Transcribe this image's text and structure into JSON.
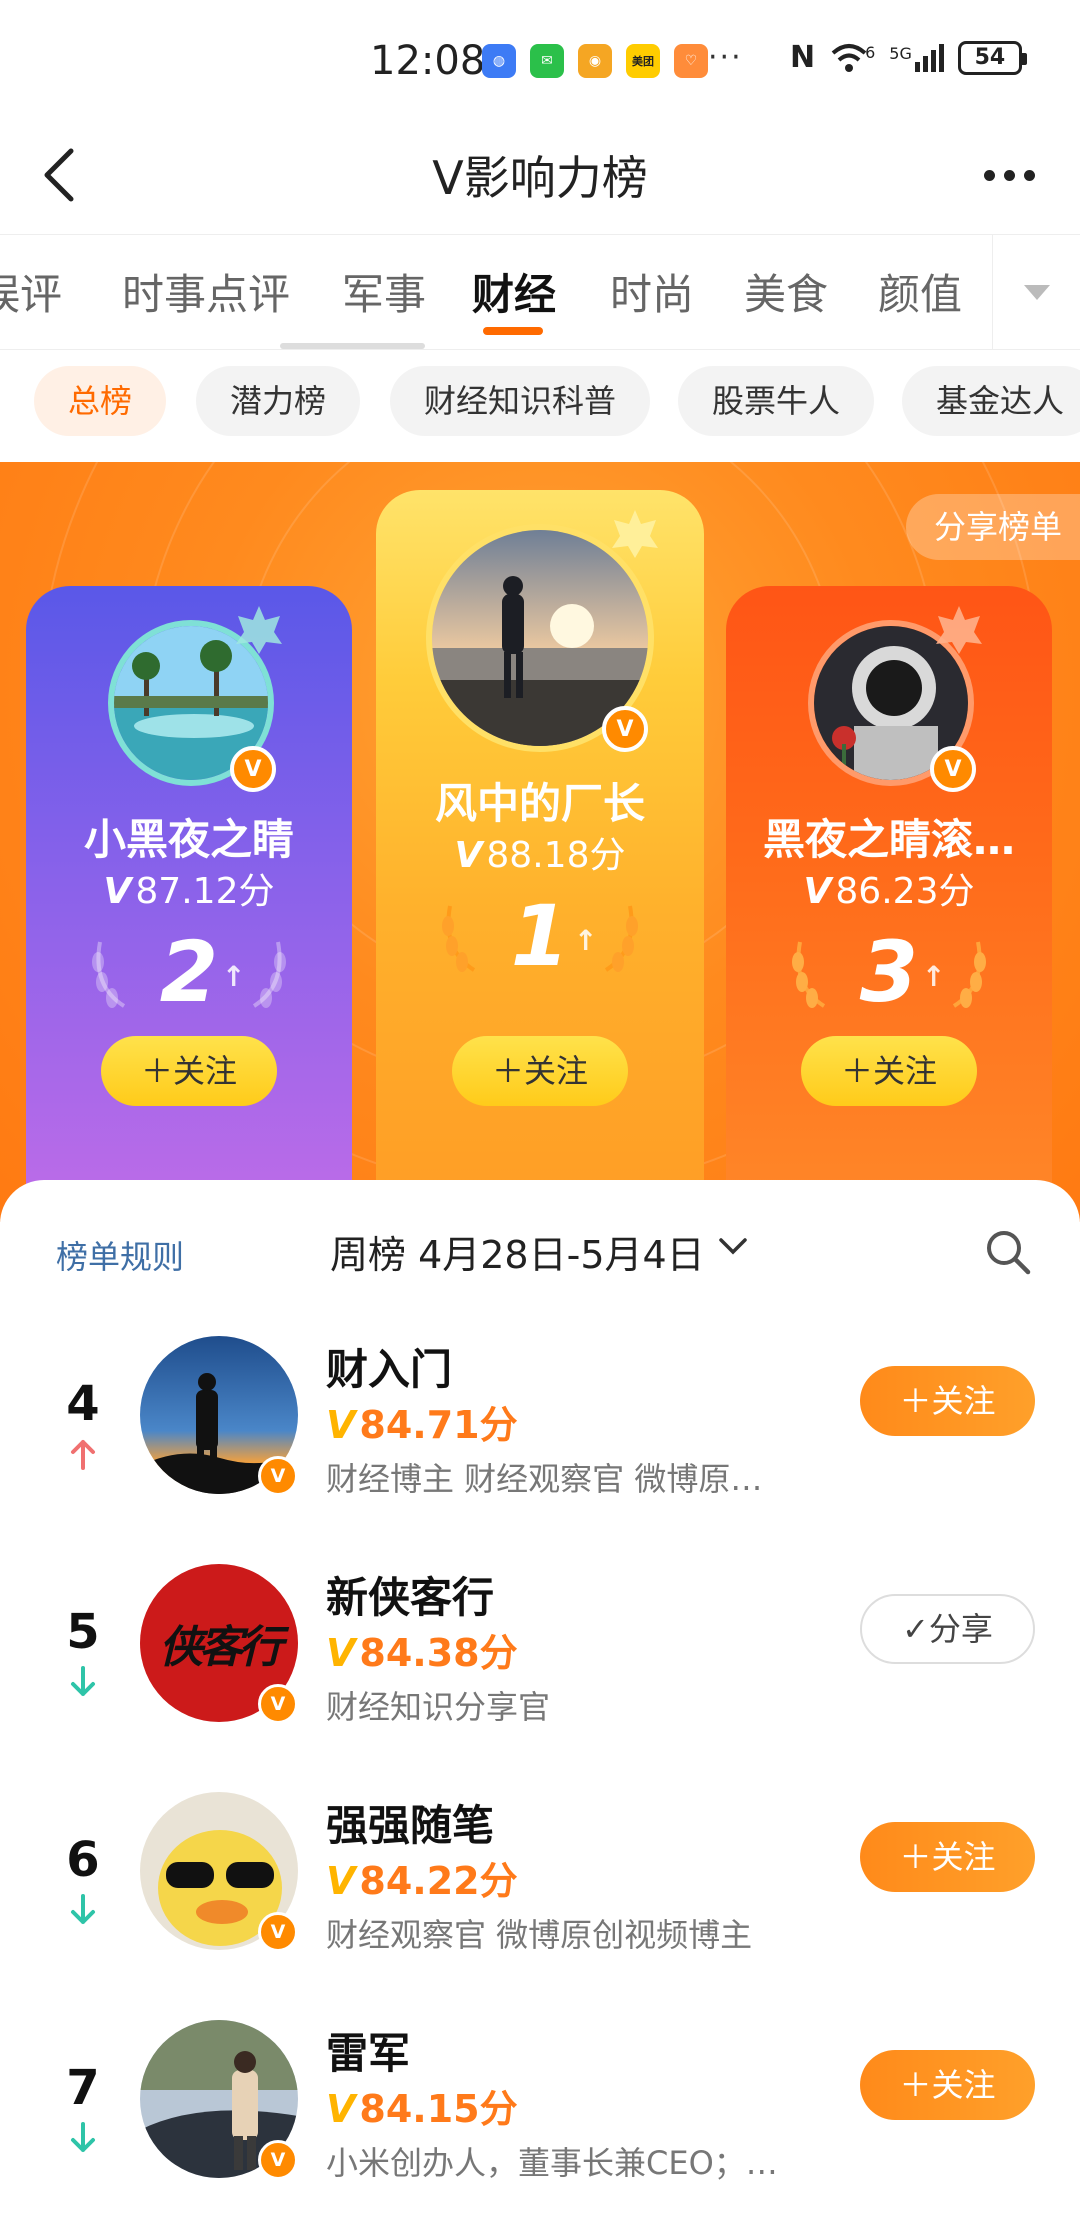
{
  "status_bar": {
    "time": "12:08",
    "app_icons": [
      {
        "name": "blue-app-icon",
        "color": "#3d7bf5",
        "glyph": "◍"
      },
      {
        "name": "wechat-icon",
        "color": "#2bc04a",
        "glyph": "✉"
      },
      {
        "name": "weibo-icon",
        "color": "#f5a623",
        "glyph": "◉"
      },
      {
        "name": "meituan-icon",
        "color": "#ffcc00",
        "glyph": "美团"
      },
      {
        "name": "orange-app-icon",
        "color": "#ff8c3a",
        "glyph": "♡"
      }
    ],
    "more": "···",
    "nfc": "N",
    "wifi_label": "6",
    "network_label": "5G",
    "battery": "54"
  },
  "header": {
    "title": "V影响力榜"
  },
  "category_tabs": [
    {
      "label": "娱评"
    },
    {
      "label": "时事点评"
    },
    {
      "label": "军事"
    },
    {
      "label": "财经",
      "active": true
    },
    {
      "label": "时尚"
    },
    {
      "label": "美食"
    },
    {
      "label": "颜值"
    }
  ],
  "sub_tabs": [
    {
      "label": "总榜",
      "active": true
    },
    {
      "label": "潜力榜"
    },
    {
      "label": "财经知识科普"
    },
    {
      "label": "股票牛人"
    },
    {
      "label": "基金达人"
    }
  ],
  "hero": {
    "share_label": "分享榜单",
    "follow_label": "＋关注",
    "podium": [
      {
        "rank": "2",
        "name": "小黑夜之睛",
        "v": "V",
        "score": "87.12分",
        "trend": "up"
      },
      {
        "rank": "1",
        "name": "风中的厂长",
        "v": "V",
        "score": "88.18分",
        "trend": "up"
      },
      {
        "rank": "3",
        "name": "黑夜之睛滚…",
        "v": "V",
        "score": "86.23分",
        "trend": "up"
      }
    ]
  },
  "list": {
    "rules_label": "榜单规则",
    "period": "周榜 4月28日-5月4日",
    "v_mark": "V",
    "badge": "V",
    "items": [
      {
        "rank": "4",
        "trend": "up",
        "name": "财入门",
        "score": "84.71分",
        "desc": "财经博主 财经观察官 微博原…",
        "action": "＋关注",
        "action_type": "follow"
      },
      {
        "rank": "5",
        "trend": "down",
        "name": "新侠客行",
        "score": "84.38分",
        "desc": "财经知识分享官",
        "action": "✓分享",
        "action_type": "share",
        "avatar_text": "侠客行"
      },
      {
        "rank": "6",
        "trend": "down",
        "name": "强强随笔",
        "score": "84.22分",
        "desc": "财经观察官 微博原创视频博主",
        "action": "＋关注",
        "action_type": "follow"
      },
      {
        "rank": "7",
        "trend": "down",
        "name": "雷军",
        "score": "84.15分",
        "desc": "小米创办人，董事长兼CEO；…",
        "action": "＋关注",
        "action_type": "follow"
      }
    ]
  },
  "colors": {
    "accent": "#ff6a00",
    "trend_up": "#f07070",
    "trend_down": "#2ec4a8",
    "link": "#3f6fa6"
  }
}
